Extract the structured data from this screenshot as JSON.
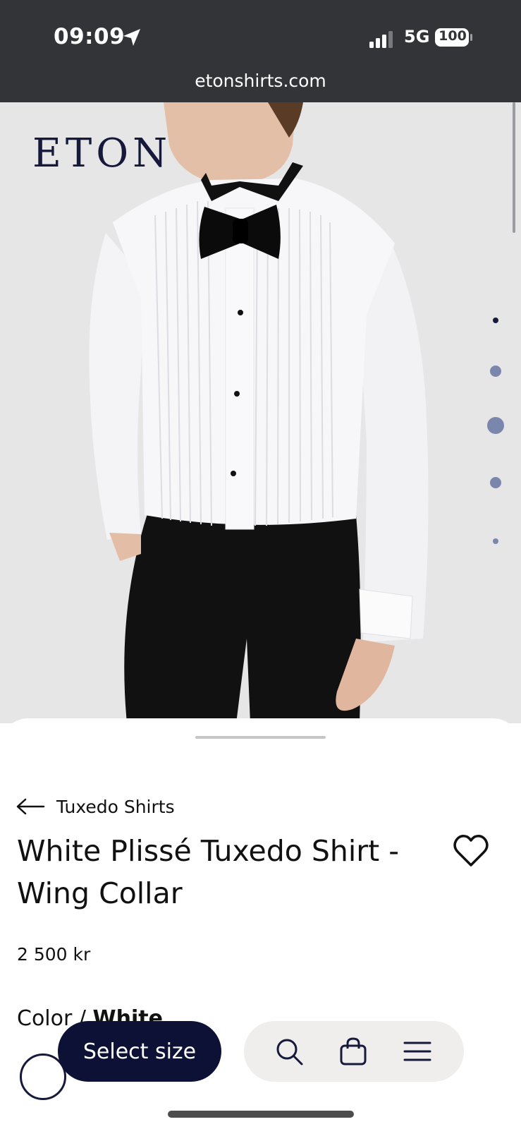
{
  "status_bar": {
    "time": "09:09",
    "network": "5G",
    "battery": "100"
  },
  "browser": {
    "url": "etonshirts.com"
  },
  "hero": {
    "brand": "ETON",
    "image": "model wearing white pleated tuxedo shirt with black bow tie",
    "carousel_dots": 5
  },
  "product": {
    "breadcrumb": "Tuxedo Shirts",
    "title": "White Plissé Tuxedo Shirt - Wing Collar",
    "price": "2 500 kr",
    "color_label": "Color /",
    "color_value": "White"
  },
  "actions": {
    "select_size": "Select size"
  },
  "icons": [
    "location-arrow-icon",
    "signal-icon",
    "battery-icon",
    "back-arrow-icon",
    "heart-icon",
    "search-icon",
    "bag-icon",
    "menu-icon"
  ],
  "colors": {
    "brand_navy": "#0e1136",
    "status_bg": "#323437",
    "hero_bg": "#e6e6e7",
    "dot": "#7b86ad"
  }
}
